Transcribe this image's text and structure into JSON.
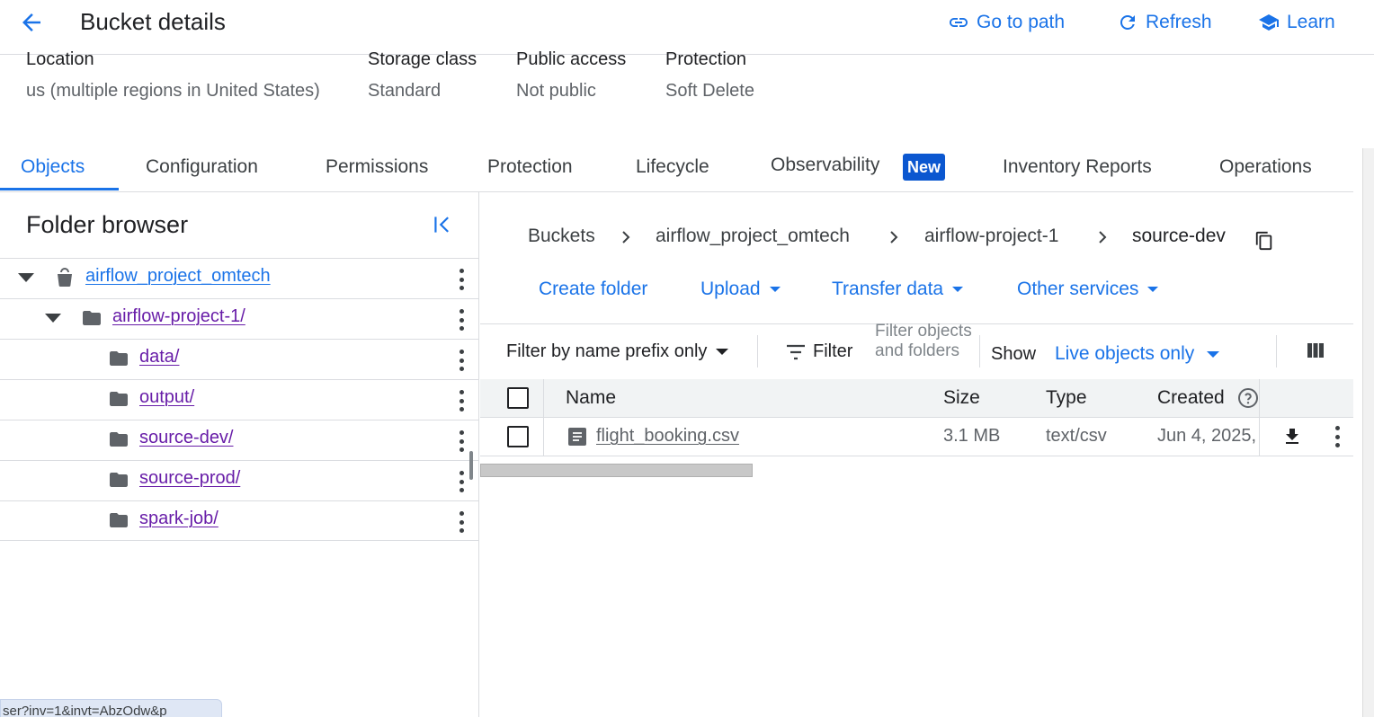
{
  "header": {
    "title": "Bucket details",
    "actions": [
      {
        "label": "Go to path",
        "icon": "link-icon"
      },
      {
        "label": "Refresh",
        "icon": "refresh-icon"
      },
      {
        "label": "Learn",
        "icon": "school-icon"
      }
    ]
  },
  "info": {
    "location": {
      "label": "Location",
      "value": "us (multiple regions in United States)"
    },
    "storage_class": {
      "label": "Storage class",
      "value": "Standard"
    },
    "public_access": {
      "label": "Public access",
      "value": "Not public"
    },
    "protection": {
      "label": "Protection",
      "value": "Soft Delete"
    }
  },
  "tabs": [
    {
      "label": "Objects",
      "active": true
    },
    {
      "label": "Configuration"
    },
    {
      "label": "Permissions"
    },
    {
      "label": "Protection"
    },
    {
      "label": "Lifecycle"
    },
    {
      "label": "Observability",
      "badge": "New"
    },
    {
      "label": "Inventory Reports"
    },
    {
      "label": "Operations"
    }
  ],
  "folder_browser": {
    "title": "Folder browser",
    "tree": [
      {
        "label": "airflow_project_omtech",
        "type": "bucket",
        "expanded": true
      },
      {
        "label": "airflow-project-1/",
        "type": "folder",
        "expanded": true
      },
      {
        "label": "data/",
        "type": "folder"
      },
      {
        "label": "output/",
        "type": "folder"
      },
      {
        "label": "source-dev/",
        "type": "folder"
      },
      {
        "label": "source-prod/",
        "type": "folder"
      },
      {
        "label": "spark-job/",
        "type": "folder"
      }
    ],
    "url_tooltip": "ser?inv=1&invt=AbzOdw&p"
  },
  "breadcrumb": [
    "Buckets",
    "airflow_project_omtech",
    "airflow-project-1",
    "source-dev"
  ],
  "actions": {
    "create_folder": "Create folder",
    "upload": "Upload",
    "transfer_data": "Transfer data",
    "other_services": "Other services"
  },
  "filter": {
    "mode": "Filter by name prefix only",
    "filter_label": "Filter",
    "placeholder": "Filter objects and folders",
    "show_label": "Show",
    "show_value": "Live objects only"
  },
  "table": {
    "columns": [
      "Name",
      "Size",
      "Type",
      "Created"
    ],
    "rows": [
      {
        "name": "flight_booking.csv",
        "size": "3.1 MB",
        "type": "text/csv",
        "created": "Jun 4, 2025,"
      }
    ]
  },
  "colors": {
    "accent": "#1a73e8",
    "visited_link": "#681da8",
    "badge": "#0b57d0"
  }
}
